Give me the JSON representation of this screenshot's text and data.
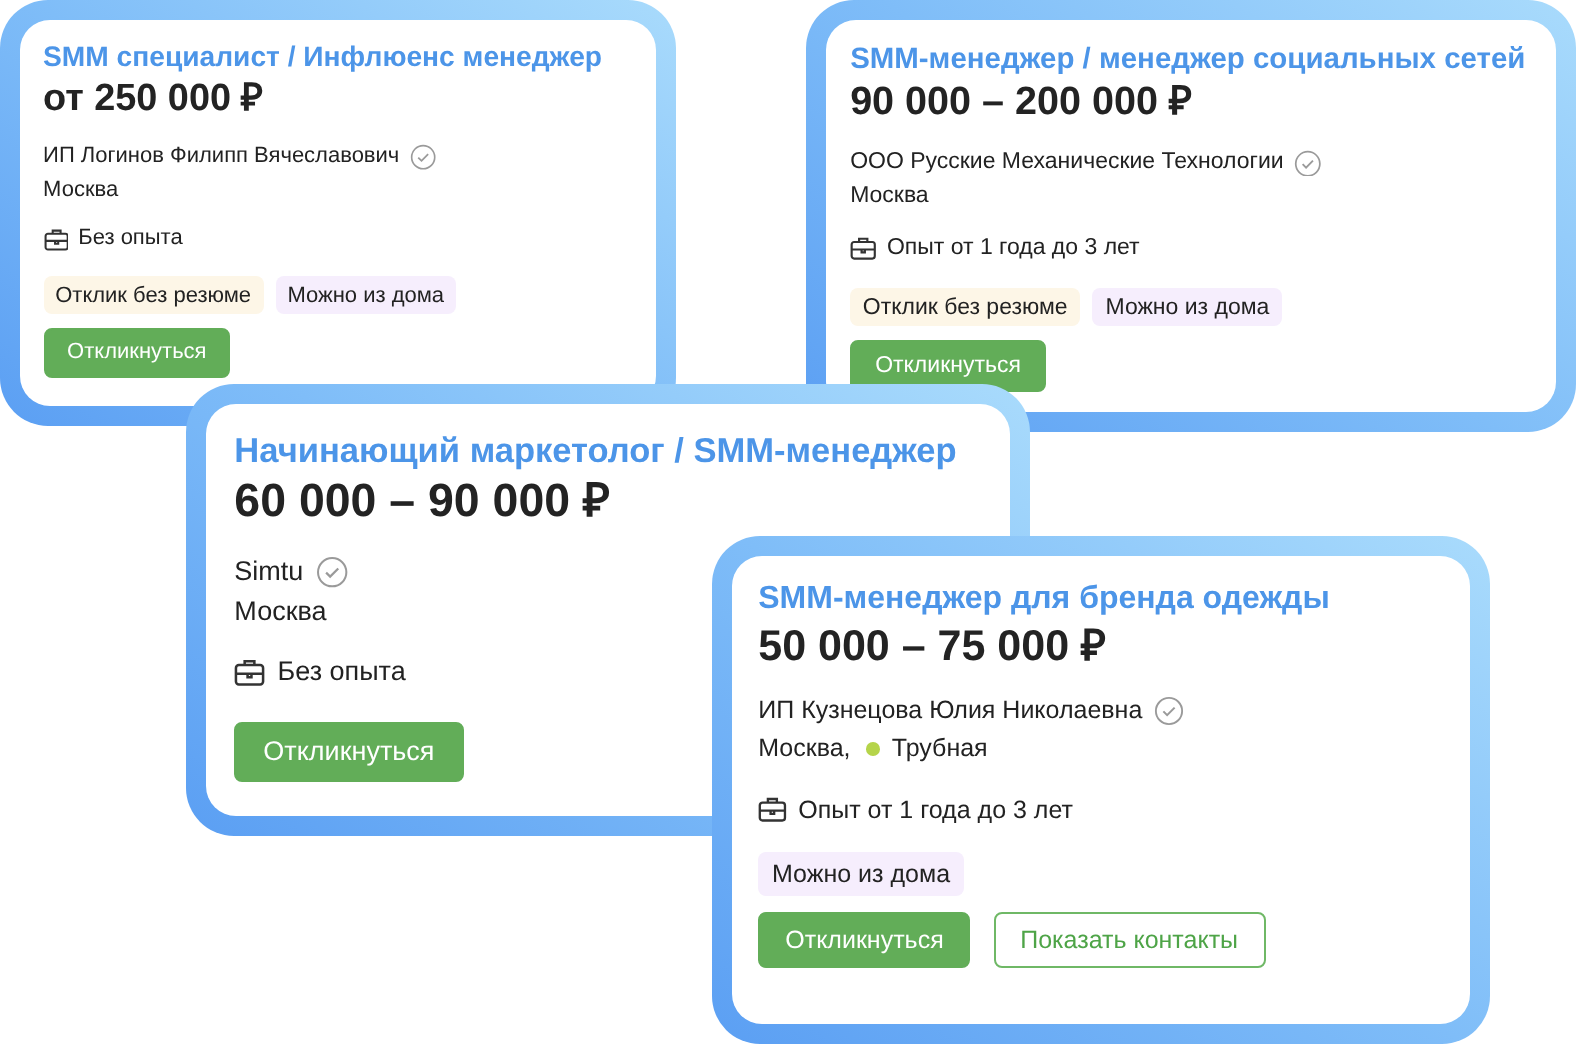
{
  "cards": [
    {
      "title": "SMM специалист / Инфлюенс менеджер",
      "salary": "от 250 000 ₽",
      "company": "ИП Логинов Филипп Вячеславович",
      "verified": true,
      "city": "Москва",
      "experience": "Без опыта",
      "tags": [
        {
          "label": "Отклик без резюме",
          "kind": "no_resume"
        },
        {
          "label": "Можно из дома",
          "kind": "remote"
        }
      ],
      "buttons": [
        {
          "label": "Откликнуться",
          "kind": "primary"
        }
      ]
    },
    {
      "title": "SMM-менеджер / менеджер социальных сетей",
      "salary": "90 000 – 200 000 ₽",
      "company": "ООО Русские Механические Технологии",
      "verified": true,
      "city": "Москва",
      "experience": "Опыт от 1 года до 3 лет",
      "tags": [
        {
          "label": "Отклик без резюме",
          "kind": "no_resume"
        },
        {
          "label": "Можно из дома",
          "kind": "remote"
        }
      ],
      "buttons": [
        {
          "label": "Откликнуться",
          "kind": "primary"
        }
      ]
    },
    {
      "title": "Начинающий маркетолог / SMM-менеджер",
      "salary": "60 000 – 90 000 ₽",
      "company": "Simtu",
      "verified": true,
      "city": "Москва",
      "experience": "Без опыта",
      "buttons": [
        {
          "label": "Откликнуться",
          "kind": "primary"
        }
      ]
    },
    {
      "title": "SMM-менеджер для бренда одежды",
      "salary": "50 000 – 75 000 ₽",
      "company": "ИП Кузнецова Юлия Николаевна",
      "verified": true,
      "city": "Москва,",
      "metro": {
        "name": "Трубная",
        "color": "#b5d44a"
      },
      "experience": "Опыт от 1 года до 3 лет",
      "tags": [
        {
          "label": "Можно из дома",
          "kind": "remote"
        }
      ],
      "buttons": [
        {
          "label": "Откликнуться",
          "kind": "primary"
        },
        {
          "label": "Показать контакты",
          "kind": "outline"
        }
      ]
    }
  ]
}
